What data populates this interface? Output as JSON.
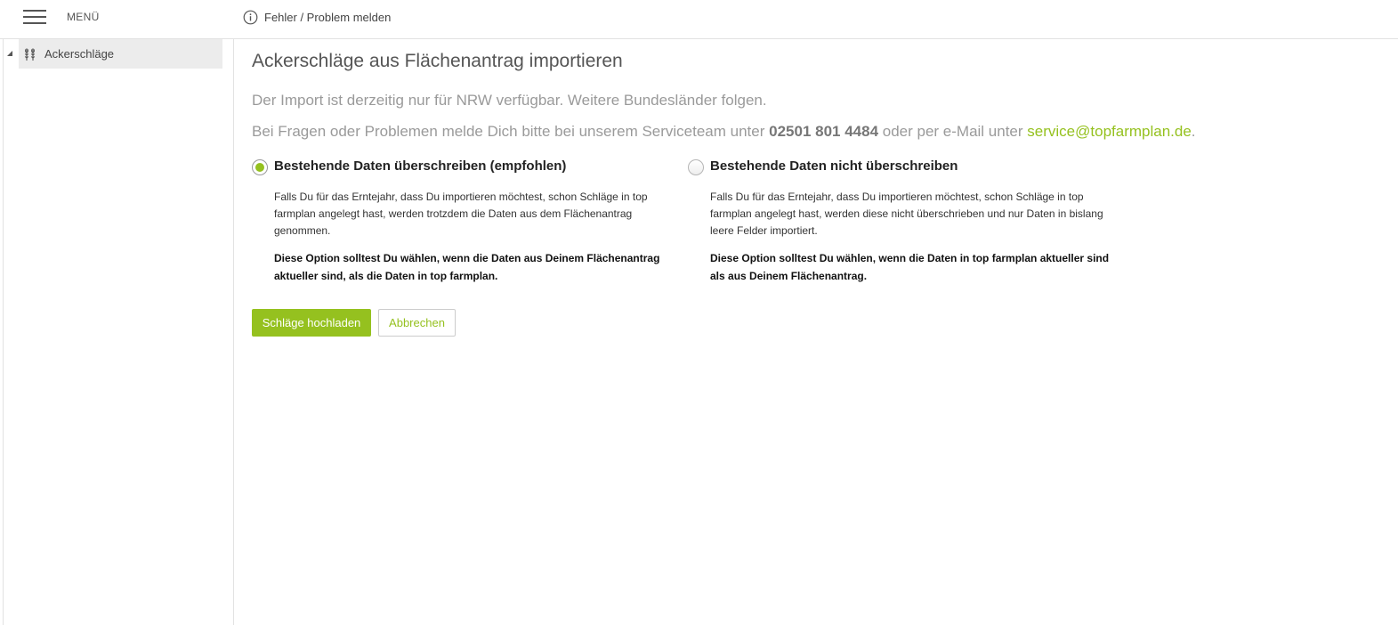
{
  "header": {
    "menu_label": "MENÜ",
    "report_label": "Fehler / Problem melden",
    "report_icon": "info-icon"
  },
  "sidebar": {
    "items": [
      {
        "label": "Ackerschläge",
        "icon": "crop-icon",
        "expanded": true,
        "selected": true
      }
    ]
  },
  "main": {
    "title": "Ackerschläge aus Flächenantrag importieren",
    "notice": "Der Import ist derzeitig nur für NRW verfügbar. Weitere Bundesländer folgen.",
    "contact": {
      "prefix": "Bei Fragen oder Problemen melde Dich bitte bei unserem Serviceteam unter ",
      "phone": "02501 801 4484",
      "middle": " oder per e-Mail unter ",
      "email": "service@topfarmplan.de",
      "suffix": "."
    },
    "options": [
      {
        "title": "Bestehende Daten überschreiben (empfohlen)",
        "selected": true,
        "description": "Falls Du für das Erntejahr, dass Du importieren möchtest, schon Schläge in top farmplan angelegt hast, werden trotzdem die Daten aus dem Flächenantrag genommen.",
        "advice": "Diese Option solltest Du wählen, wenn die Daten aus Deinem Flächenantrag aktueller sind, als die Daten in top farmplan."
      },
      {
        "title": "Bestehende Daten nicht überschreiben",
        "selected": false,
        "description": "Falls Du für das Erntejahr, dass Du importieren möchtest, schon Schläge in top farmplan angelegt hast, werden diese nicht überschrieben und nur Daten in bislang leere Felder importiert.",
        "advice": "Diese Option solltest Du wählen, wenn die Daten in top farmplan aktueller sind als aus Deinem Flächenantrag."
      }
    ],
    "buttons": {
      "upload_label": "Schläge hochladen",
      "cancel_label": "Abbrechen"
    }
  },
  "colors": {
    "accent": "#95c11f",
    "text": "#333333",
    "muted": "#9a9a9a",
    "sidebar_selected": "#ececec"
  }
}
